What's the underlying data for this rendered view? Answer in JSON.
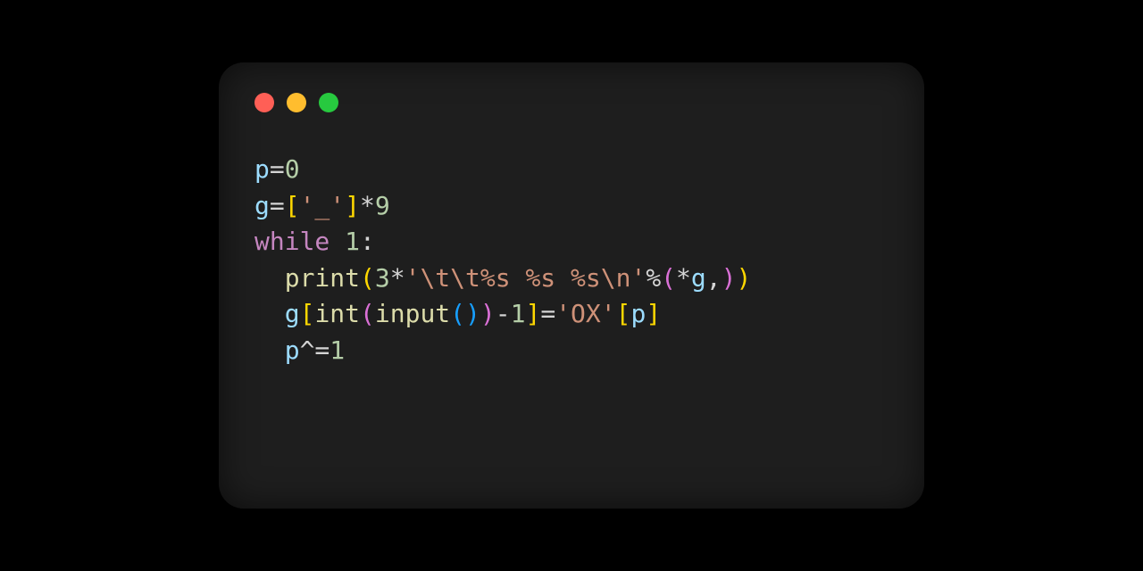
{
  "code": {
    "l1": {
      "v": "p",
      "eq": "=",
      "n": "0"
    },
    "l2": {
      "v": "g",
      "eq": "=",
      "lb1": "[",
      "s": "'_'",
      "rb1": "]",
      "star": "*",
      "n": "9"
    },
    "l3": {
      "kw": "while",
      "sp": " ",
      "n": "1",
      "colon": ":"
    },
    "l4": {
      "indent": "  ",
      "fn": "print",
      "lp": "(",
      "n3": "3",
      "star": "*",
      "s": "'\\t\\t%s %s %s\\n'",
      "pct": "%",
      "lp2": "(",
      "star2": "*",
      "v": "g",
      "comma": ",",
      "rp2": ")",
      "rp": ")"
    },
    "l5": {
      "indent": "  ",
      "v": "g",
      "lb": "[",
      "fn1": "int",
      "lp1": "(",
      "fn2": "input",
      "lp2": "(",
      "rp2": ")",
      "rp1": ")",
      "minus": "-",
      "n1": "1",
      "rb": "]",
      "eq": "=",
      "s": "'OX'",
      "lb2": "[",
      "v2": "p",
      "rb2": "]"
    },
    "l6": {
      "indent": "  ",
      "v": "p",
      "xor": "^=",
      "n": "1"
    }
  }
}
